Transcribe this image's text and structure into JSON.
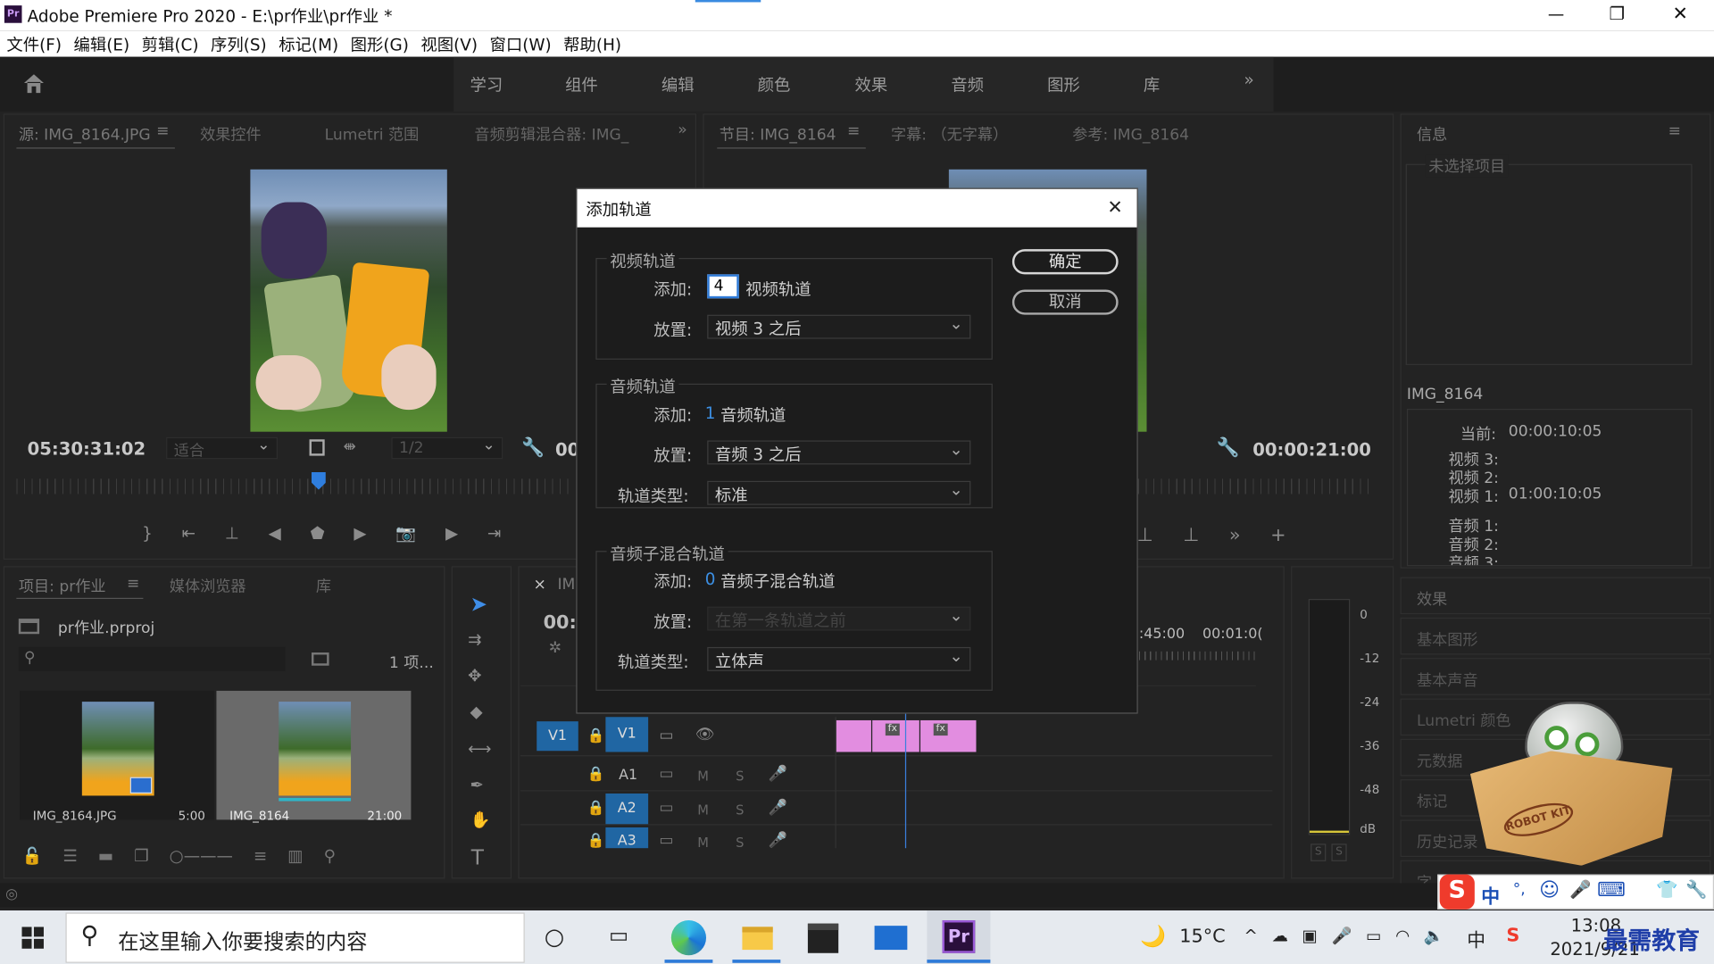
{
  "window": {
    "app_icon": "Pr",
    "title": "Adobe Premiere Pro 2020 - E:\\pr作业\\pr作业 *",
    "minimize": "—",
    "maximize": "❐",
    "close": "✕"
  },
  "menu": [
    "文件(F)",
    "编辑(E)",
    "剪辑(C)",
    "序列(S)",
    "标记(M)",
    "图形(G)",
    "视图(V)",
    "窗口(W)",
    "帮助(H)"
  ],
  "workspaces": [
    "学习",
    "组件",
    "编辑",
    "颜色",
    "效果",
    "音频",
    "图形",
    "库"
  ],
  "workspace_more": "»",
  "source_panel": {
    "tabs": [
      "源: IMG_8164.JPG",
      "效果控件",
      "Lumetri 范围",
      "音频剪辑混合器: IMG_"
    ],
    "menu": "≡",
    "more": "»",
    "timecode": "05:30:31:02",
    "fit": "适合",
    "ratio": "1/2",
    "tc2": "00"
  },
  "program_panel": {
    "tabs": [
      "节目: IMG_8164",
      "字幕: （无字幕）",
      "参考: IMG_8164"
    ],
    "menu": "≡",
    "timecode": "00:00:21:00"
  },
  "info_panel": {
    "title": "信息",
    "menu": "≡",
    "none_selected": "未选择项目",
    "clip_name": "IMG_8164",
    "rows": [
      {
        "label": "当前:",
        "value": "00:00:10:05"
      },
      {
        "label": "视频 3:",
        "value": ""
      },
      {
        "label": "视频 2:",
        "value": ""
      },
      {
        "label": "视频 1:",
        "value": "01:00:10:05"
      },
      {
        "label": "音频 1:",
        "value": ""
      },
      {
        "label": "音频 2:",
        "value": ""
      },
      {
        "label": "音频 3:",
        "value": ""
      }
    ]
  },
  "right_panels": [
    "效果",
    "基本图形",
    "基本声音",
    "Lumetri 颜色",
    "元数据",
    "标记",
    "历史记录",
    "字..."
  ],
  "project_panel": {
    "tabs": [
      "项目: pr作业",
      "媒体浏览器",
      "库"
    ],
    "menu": "≡",
    "file": "pr作业.prproj",
    "count": "1 项...",
    "items": [
      {
        "name": "IMG_8164.JPG",
        "dur": "5:00"
      },
      {
        "name": "IMG_8164",
        "dur": "21:00"
      }
    ]
  },
  "timeline": {
    "close": "×",
    "tab": "IM",
    "tc": "00:(",
    "ruler": [
      ":45:00",
      "00:01:0("
    ],
    "tracks": [
      {
        "name": "V1",
        "target": "V1"
      },
      {
        "name": "A1",
        "target": "A1"
      },
      {
        "name": "A2",
        "target": "A2"
      },
      {
        "name": "A3",
        "target": "A3"
      }
    ],
    "m": "M",
    "s": "S",
    "fx": "fx"
  },
  "meter": {
    "scale": [
      "0",
      "-12",
      "-24",
      "-36",
      "-48",
      "dB"
    ],
    "solo": [
      "S",
      "S"
    ]
  },
  "dialog": {
    "title": "添加轨道",
    "close": "✕",
    "ok": "确定",
    "cancel": "取消",
    "video": {
      "legend": "视频轨道",
      "add_label": "添加:",
      "add_value": "4",
      "add_unit": "视频轨道",
      "place_label": "放置:",
      "place_value": "视频 3 之后"
    },
    "audio": {
      "legend": "音频轨道",
      "add_label": "添加:",
      "add_value": "1",
      "add_unit": "音频轨道",
      "place_label": "放置:",
      "place_value": "音频 3 之后",
      "type_label": "轨道类型:",
      "type_value": "标准"
    },
    "submix": {
      "legend": "音频子混合轨道",
      "add_label": "添加:",
      "add_value": "0",
      "add_unit": "音频子混合轨道",
      "place_label": "放置:",
      "place_value": "在第一条轨道之前",
      "type_label": "轨道类型:",
      "type_value": "立体声"
    }
  },
  "taskbar": {
    "search": "在这里输入你要搜索的内容",
    "weather": "15°C",
    "ime": "中",
    "time": "13:08",
    "date": "2021/9/21",
    "pr": "Pr"
  },
  "ime_bar": [
    "中",
    "°,",
    "☺",
    "🎤",
    "⌨",
    "👕",
    "🔧"
  ],
  "watermark": "最需教育",
  "robot_kit": "ROBOT KIT"
}
